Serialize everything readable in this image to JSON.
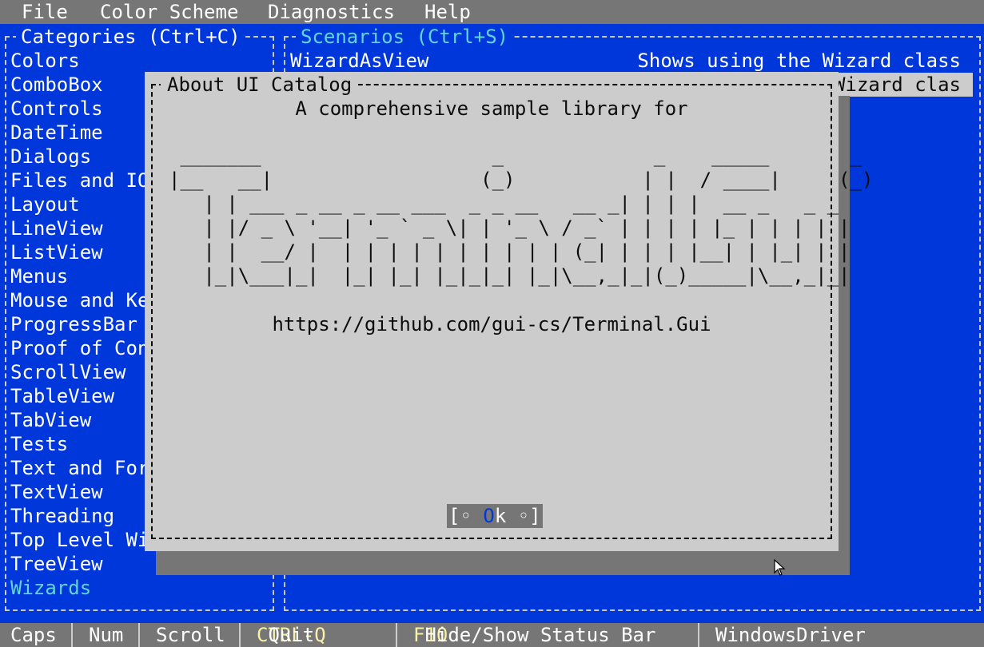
{
  "menubar": {
    "items": [
      "File",
      "Color Scheme",
      "Diagnostics",
      "Help"
    ]
  },
  "categories": {
    "title": "Categories (Ctrl+C)",
    "items": [
      "Colors",
      "ComboBox",
      "Controls",
      "DateTime",
      "Dialogs",
      "Files and IO",
      "Layout",
      "LineView",
      "ListView",
      "Menus",
      "Mouse and Ke",
      "ProgressBar",
      "Proof of Con",
      "ScrollView",
      "TableView",
      "TabView",
      "Tests",
      "Text and For",
      "TextView",
      "Threading",
      "Top Level Wi",
      "TreeView",
      "Wizards"
    ],
    "selected": "Wizards"
  },
  "scenarios": {
    "title": "Scenarios (Ctrl+S)",
    "rows": [
      {
        "name": "WizardAsView",
        "desc": "Shows using the Wizard class"
      },
      {
        "name": "",
        "desc": "Wizard clas"
      }
    ]
  },
  "dialog": {
    "title": "About UI Catalog",
    "subtitle": "A comprehensive sample library for",
    "ascii_art": [
      " _______                    _             _    _____       _  ",
      "|__   __|                  (_)           | |  / ____|     (_) ",
      "   | | ___ _ __ _ __ ___  _ _ __   __ _| | | |  __ _   _ _  ",
      "   | |/ _ \\ '__| '_ ` _ \\| | '_ \\ / _` | | | | |_ | | | | | ",
      "   | |  __/ |  | | | | | | | | | | (_| | | | |__| | |_| | | ",
      "   |_|\\___|_|  |_| |_| |_|_|_| |_|\\__,_|_|(_)_____|\\__,_|_| "
    ],
    "url": "https://github.com/gui-cs/Terminal.Gui",
    "ok_button": {
      "open": "[◦ ",
      "hotkey": "O",
      "rest": "k",
      "close": " ◦]"
    }
  },
  "statusbar": {
    "caps": "Caps",
    "num": "Num",
    "scroll": "Scroll",
    "quit_key": "CTRL-Q",
    "quit_label": "Quit",
    "toggle_key": "F10",
    "toggle_label": "Hide/Show Status Bar",
    "driver": "WindowsDriver"
  },
  "colors": {
    "background": "#0037DA",
    "menubar": "#767676",
    "dialog": "#cccccc",
    "selected_category": "#61D6D6",
    "hotkey": "#F9F1A5"
  },
  "icons": {
    "cursor": "mouse-pointer-icon"
  }
}
